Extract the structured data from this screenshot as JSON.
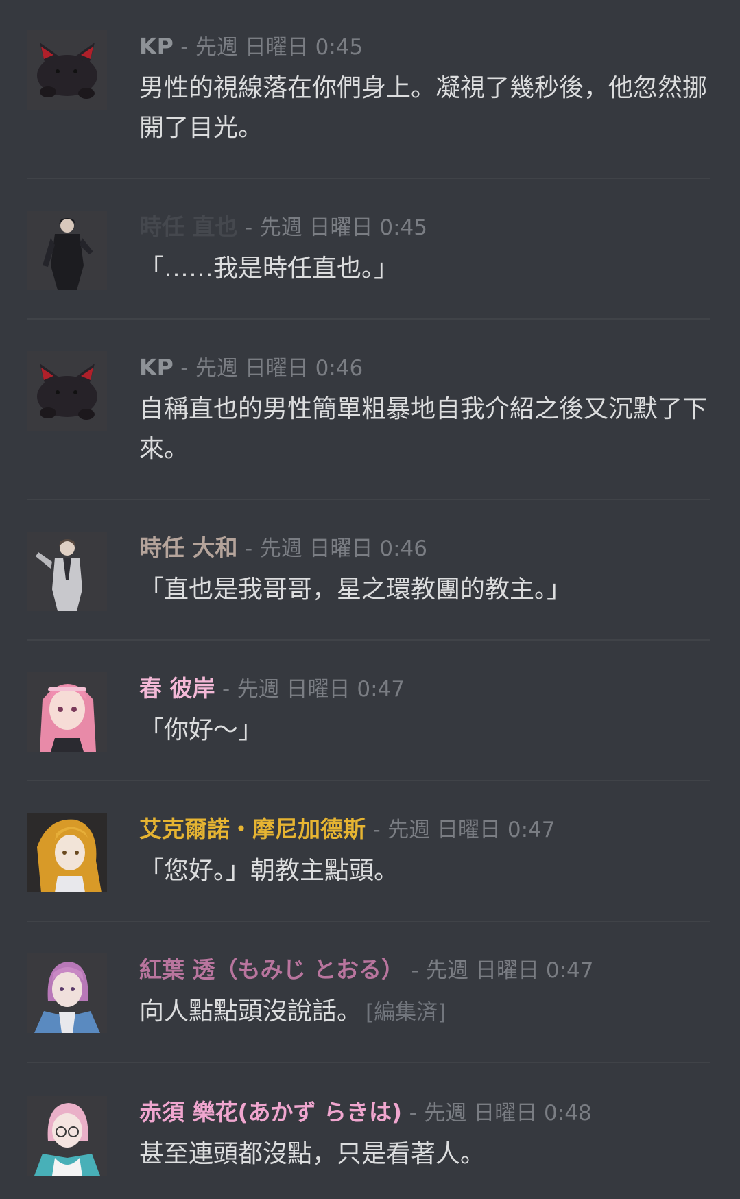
{
  "colors": {
    "background": "#36393f",
    "divider": "#404348",
    "text": "#dcddde",
    "meta": "#7a7d83"
  },
  "messages": [
    {
      "author": "KP",
      "author_color": "#8e9297",
      "separator": "-",
      "timestamp": "先週 日曜日 0:45",
      "content": "男性的視線落在你們身上。凝視了幾秒後，他忽然挪開了目光。",
      "avatar_icon": "black-cat-avatar-icon"
    },
    {
      "author": "時任 直也",
      "author_color": "#45484e",
      "separator": "-",
      "timestamp": "先週 日曜日 0:45",
      "content": "「……我是時任直也。」",
      "avatar_icon": "dark-suit-man-avatar-icon"
    },
    {
      "author": "KP",
      "author_color": "#8e9297",
      "separator": "-",
      "timestamp": "先週 日曜日 0:46",
      "content": "自稱直也的男性簡單粗暴地自我介紹之後又沉默了下來。",
      "avatar_icon": "black-cat-avatar-icon"
    },
    {
      "author": "時任 大和",
      "author_color": "#b5a49b",
      "separator": "-",
      "timestamp": "先週 日曜日 0:46",
      "content": "「直也是我哥哥，星之環教團的教主。」",
      "avatar_icon": "grey-suit-man-avatar-icon"
    },
    {
      "author": "春 彼岸",
      "author_color": "#f3b8d6",
      "separator": "-",
      "timestamp": "先週 日曜日 0:47",
      "content": "「你好～」",
      "avatar_icon": "pink-hair-girl-avatar-icon"
    },
    {
      "author": "艾克爾諾・摩尼加德斯",
      "author_color": "#e6b432",
      "separator": "-",
      "timestamp": "先週 日曜日 0:47",
      "content": "「您好。」朝教主點頭。",
      "avatar_icon": "blonde-long-hair-avatar-icon"
    },
    {
      "author": "紅葉 透（もみじ とおる）",
      "author_color": "#b9759e",
      "separator": "-",
      "timestamp": "先週 日曜日 0:47",
      "content": "向人點點頭沒說話。",
      "edited": "[編集済]",
      "avatar_icon": "purple-hair-boy-avatar-icon"
    },
    {
      "author": "赤須 樂花(あかず らきは)",
      "author_color": "#f0a6cf",
      "separator": "-",
      "timestamp": "先週 日曜日 0:48",
      "content": "甚至連頭都沒點，只是看著人。",
      "avatar_icon": "pink-glasses-boy-avatar-icon"
    }
  ]
}
